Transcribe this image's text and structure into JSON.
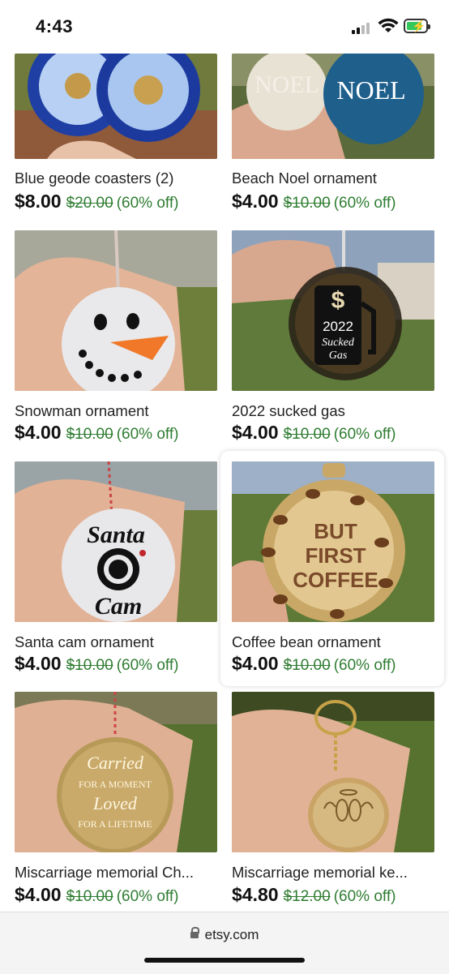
{
  "status": {
    "time": "4:43"
  },
  "listings": [
    {
      "title": "Blue geode coasters (2)",
      "price": "$8.00",
      "original": "$20.00",
      "discount": "(60% off)"
    },
    {
      "title": "Beach Noel ornament",
      "price": "$4.00",
      "original": "$10.00",
      "discount": "(60% off)"
    },
    {
      "title": "Snowman ornament",
      "price": "$4.00",
      "original": "$10.00",
      "discount": "(60% off)"
    },
    {
      "title": "2022 sucked gas",
      "price": "$4.00",
      "original": "$10.00",
      "discount": "(60% off)"
    },
    {
      "title": "Santa cam ornament",
      "price": "$4.00",
      "original": "$10.00",
      "discount": "(60% off)"
    },
    {
      "title": "Coffee bean ornament",
      "price": "$4.00",
      "original": "$10.00",
      "discount": "(60% off)"
    },
    {
      "title": "Miscarriage memorial Ch...",
      "price": "$4.00",
      "original": "$10.00",
      "discount": "(60% off)"
    },
    {
      "title": "Miscarriage memorial ke...",
      "price": "$4.80",
      "original": "$12.00",
      "discount": "(60% off)"
    }
  ],
  "image_text": {
    "noel_1": "NOEL",
    "noel_2": "NOEL",
    "gas_year": "2022",
    "gas_line1": "Sucked",
    "gas_line2": "Gas",
    "santa_top": "Santa",
    "santa_bottom": "Cam",
    "coffee_1": "BUT",
    "coffee_2": "FIRST",
    "coffee_3": "COFFEE",
    "memorial_1": "Carried",
    "memorial_2": "FOR A MOMENT",
    "memorial_3": "Loved",
    "memorial_4": "FOR A LIFETIME"
  },
  "browser": {
    "url": "etsy.com"
  },
  "colors": {
    "price_green": "#2f7d32",
    "battery_green": "#34c759"
  }
}
